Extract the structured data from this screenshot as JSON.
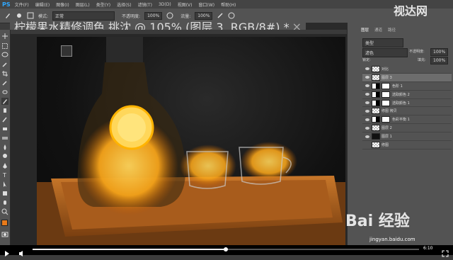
{
  "app": {
    "logo": "PS"
  },
  "menu": [
    "文件(F)",
    "编辑(E)",
    "图像(I)",
    "图层(L)",
    "类型(Y)",
    "选择(S)",
    "滤镜(T)",
    "3D(D)",
    "视图(V)",
    "窗口(W)",
    "帮助(H)"
  ],
  "options": {
    "mode_label": "模式:",
    "mode_value": "正常",
    "opacity_label": "不透明度:",
    "opacity_value": "100%",
    "flow_label": "流量:",
    "flow_value": "100%"
  },
  "document_tab": {
    "title": "柠檬果水精修调色 挑沈 @ 105% (图层 3, RGB/8#) *"
  },
  "panel": {
    "tabs": [
      "图层",
      "通道",
      "路径"
    ],
    "kind_label": "类型",
    "blend_mode": "滤色",
    "opacity_label": "不透明度:",
    "opacity_value": "100%",
    "lock_label": "锁定:",
    "fill_label": "填充:",
    "fill_value": "100%"
  },
  "layers": [
    {
      "name": "对比",
      "thumb": "check",
      "selected": false,
      "visible": true
    },
    {
      "name": "图层 3",
      "thumb": "check",
      "selected": true,
      "visible": true
    },
    {
      "name": "色阶 1",
      "thumb": "half",
      "selected": false,
      "visible": true
    },
    {
      "name": "选取颜色 2",
      "thumb": "half",
      "selected": false,
      "visible": true
    },
    {
      "name": "选取颜色 1",
      "thumb": "half",
      "selected": false,
      "visible": true
    },
    {
      "name": "修图 拷贝",
      "thumb": "check",
      "selected": false,
      "visible": true
    },
    {
      "name": "色彩平衡 1",
      "thumb": "half",
      "selected": false,
      "visible": true
    },
    {
      "name": "图层 2",
      "thumb": "check",
      "selected": false,
      "visible": true
    },
    {
      "name": "图层 1",
      "thumb": "dark",
      "selected": false,
      "visible": true
    },
    {
      "name": "修图",
      "thumb": "check",
      "selected": false,
      "visible": false
    }
  ],
  "colors": {
    "foreground": "#e87a1a",
    "background": "#ffffff",
    "accent": "#31a8ff"
  },
  "video": {
    "time": "6:10",
    "progress": 0.5
  },
  "watermarks": {
    "top_right": "视达网",
    "bottom_right": "Bai 经验",
    "url": "jingyan.baidu.com"
  }
}
